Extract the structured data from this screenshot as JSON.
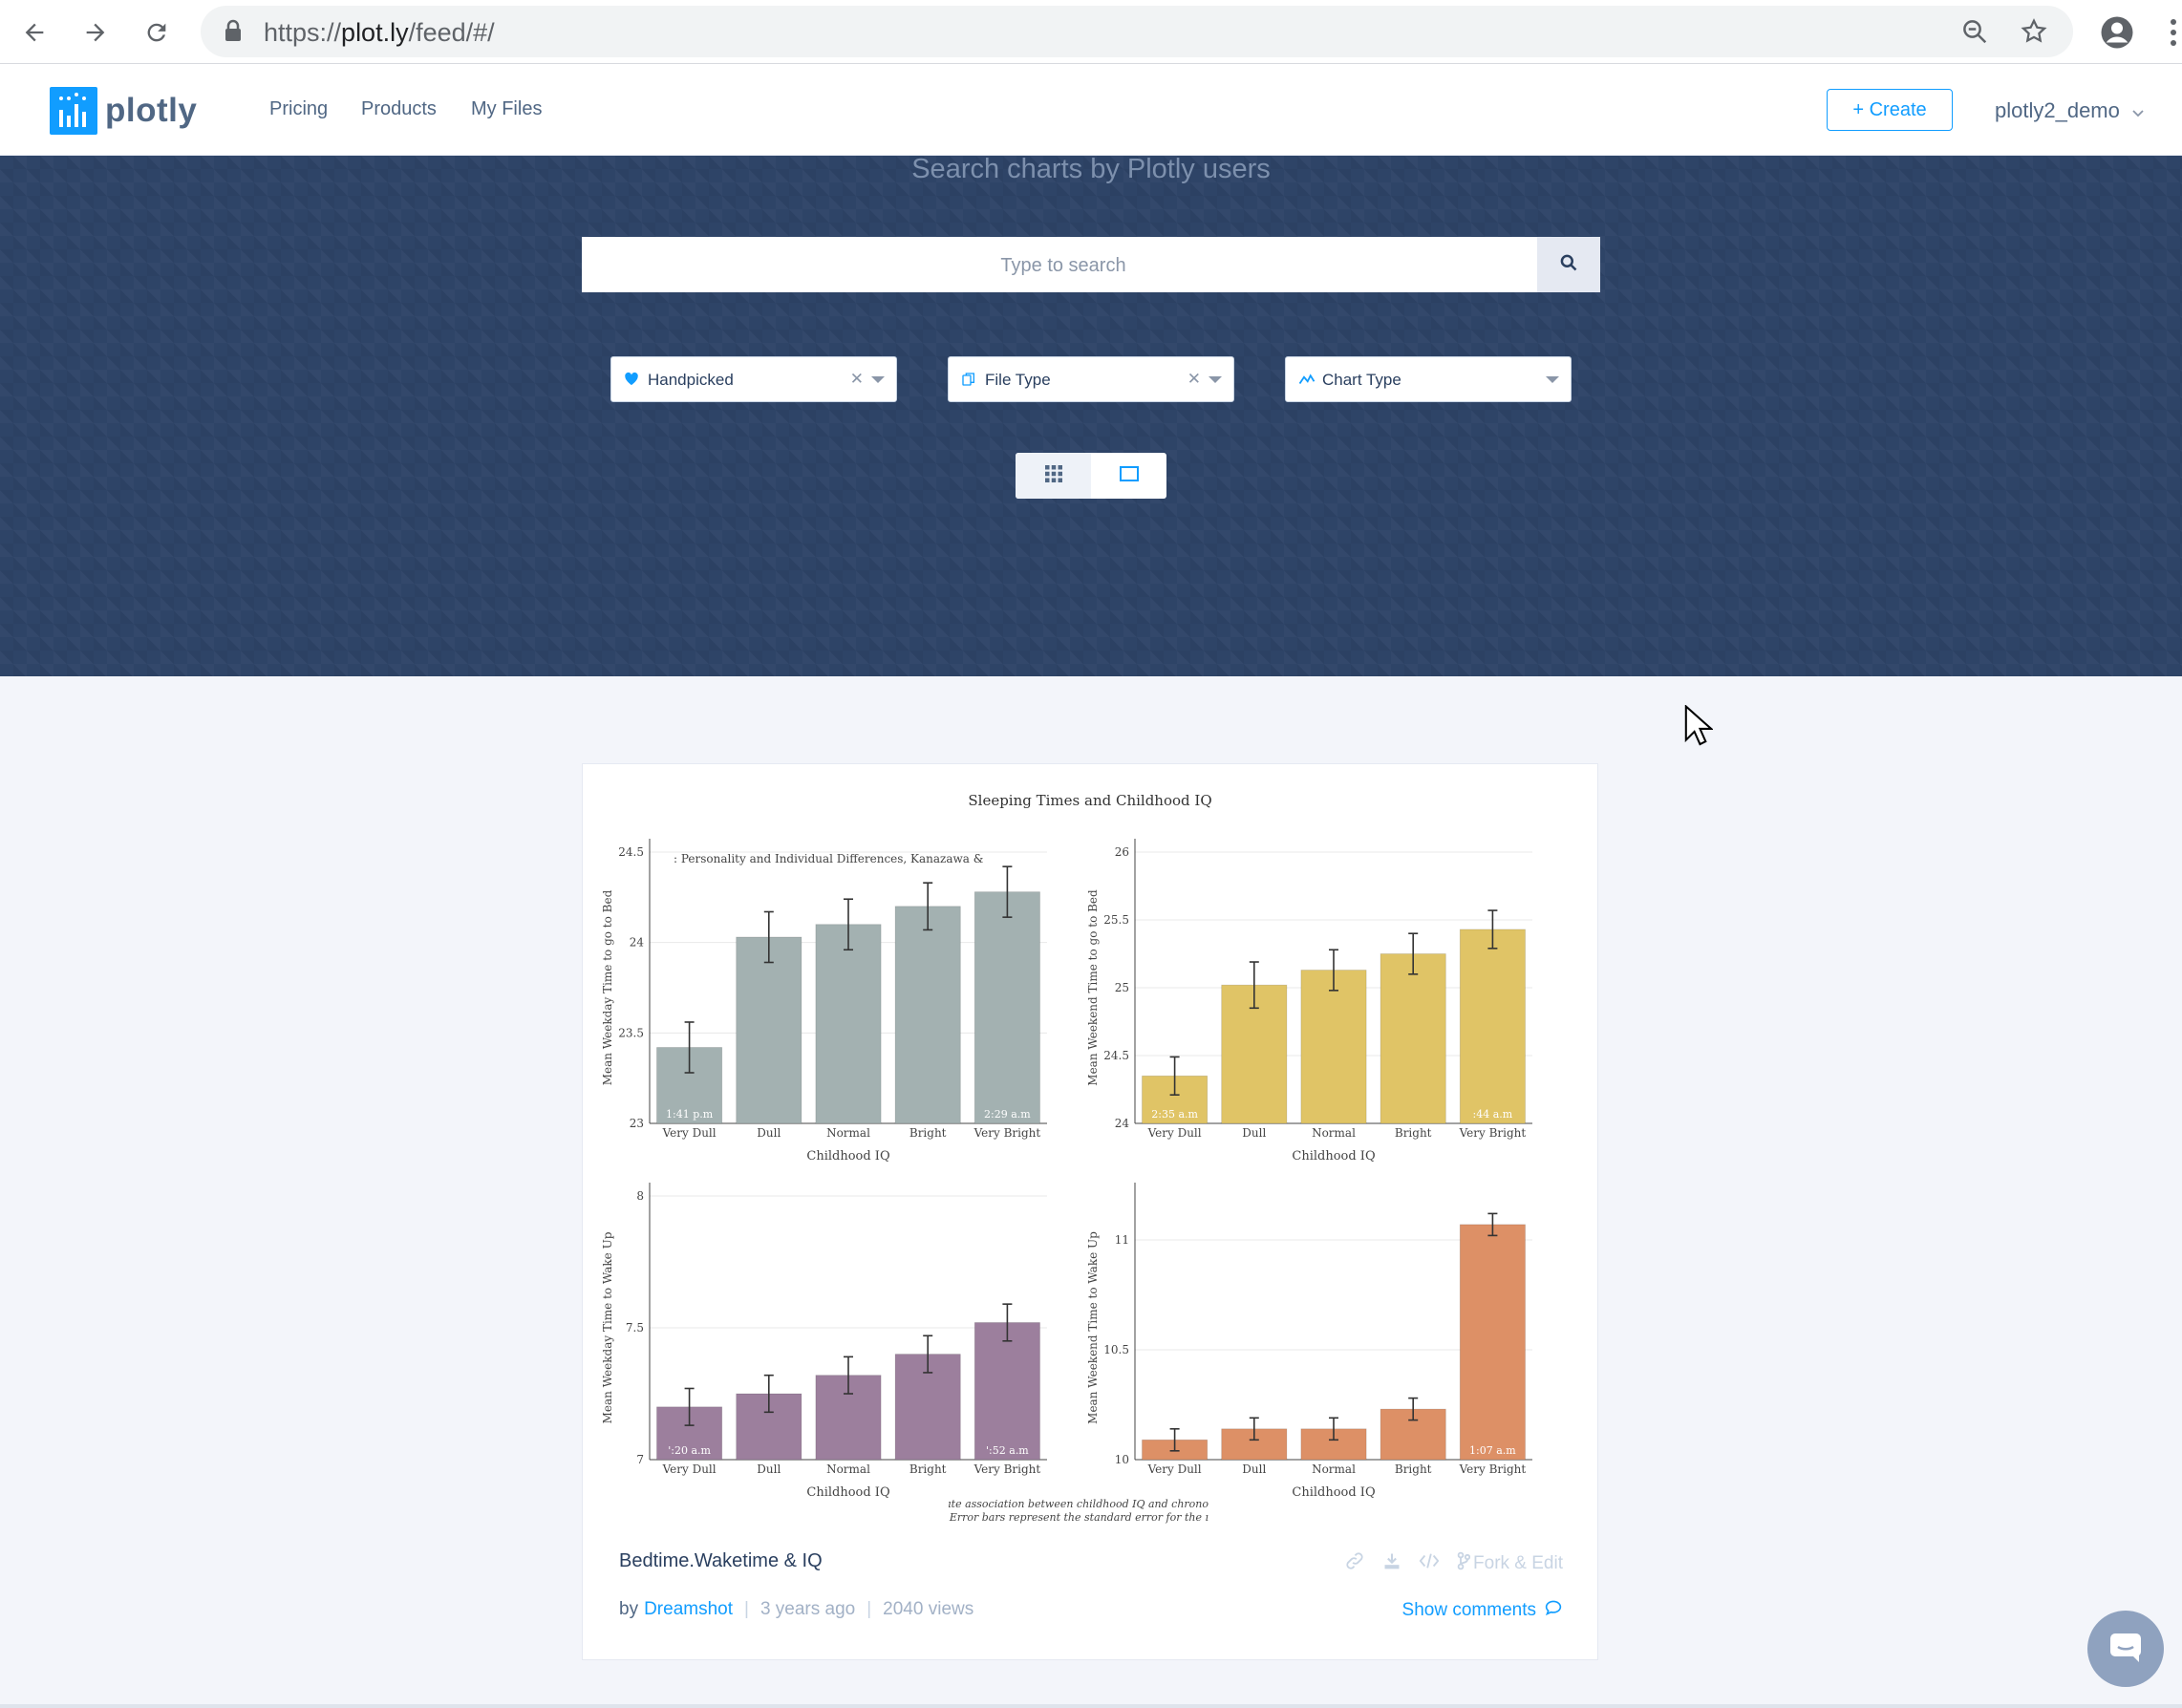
{
  "browser": {
    "url_prefix": "https://",
    "url_host": "plot.ly",
    "url_path": "/feed/#/"
  },
  "site": {
    "logo_text": "plotly",
    "nav": [
      "Pricing",
      "Products",
      "My Files"
    ],
    "create_label": "+ Create",
    "username": "plotly2_demo"
  },
  "hero": {
    "title": "Search charts by Plotly users",
    "search_placeholder": "Type to search",
    "filters": [
      {
        "label": "Handpicked",
        "icon": "heart-icon",
        "clearable": true
      },
      {
        "label": "File Type",
        "icon": "file-copy-icon",
        "clearable": true
      },
      {
        "label": "Chart Type",
        "icon": "line-chart-icon",
        "clearable": false
      }
    ]
  },
  "card": {
    "title": "Bedtime.Waketime & IQ",
    "fork_label": "Fork & Edit",
    "author_prefix": "by",
    "author": "Dreamshot",
    "age": "3 years ago",
    "views": "2040 views",
    "comments_label": "Show comments"
  },
  "chart_data": {
    "type": "bar",
    "title": "Sleeping Times and Childhood IQ",
    "source_note": ": Personality and Individual Differences, Kanazawa &",
    "caption_lines": [
      "ıte association between childhood IQ and chrono",
      "Error bars represent the standard error for the ı"
    ],
    "subplots": [
      {
        "ylabel": "Mean Weekday Time to go to Bed",
        "xlabel": "Childhood IQ",
        "categories": [
          "Very Dull",
          "Dull",
          "Normal",
          "Bright",
          "Very Bright"
        ],
        "values": [
          23.42,
          24.03,
          24.1,
          24.2,
          24.28
        ],
        "errors": [
          0.14,
          0.14,
          0.14,
          0.13,
          0.14
        ],
        "ylim": [
          23,
          24.5
        ],
        "yticks": [
          "23",
          "23.5",
          "24",
          "24.5"
        ],
        "color": "#a3b1b1",
        "bar_labels": [
          "1:41 p.m",
          "",
          "",
          "",
          "2:29 a.m"
        ]
      },
      {
        "ylabel": "Mean Weekend Time to go to Bed",
        "xlabel": "Childhood IQ",
        "categories": [
          "Very Dull",
          "Dull",
          "Normal",
          "Bright",
          "Very Bright"
        ],
        "values": [
          24.35,
          25.02,
          25.13,
          25.25,
          25.43
        ],
        "errors": [
          0.14,
          0.17,
          0.15,
          0.15,
          0.14
        ],
        "ylim": [
          24,
          26
        ],
        "yticks": [
          "24",
          "24.5",
          "25",
          "25.5",
          "26"
        ],
        "color": "#e0c466",
        "bar_labels": [
          "2:35 a.m",
          "",
          "",
          "",
          ":44 a.m"
        ]
      },
      {
        "ylabel": "Mean Weekday Time to Wake Up",
        "xlabel": "Childhood IQ",
        "categories": [
          "Very Dull",
          "Dull",
          "Normal",
          "Bright",
          "Very Bright"
        ],
        "values": [
          7.2,
          7.25,
          7.32,
          7.4,
          7.52
        ],
        "errors": [
          0.07,
          0.07,
          0.07,
          0.07,
          0.07
        ],
        "ylim": [
          7,
          8
        ],
        "yticks": [
          "7",
          "7.5",
          "8"
        ],
        "color": "#9c7f9d",
        "bar_labels": [
          "':20 a.m",
          "",
          "",
          "",
          "':52 a.m"
        ]
      },
      {
        "ylabel": "Mean Weekend Time to Wake Up",
        "xlabel": "Childhood IQ",
        "categories": [
          "Very Dull",
          "Dull",
          "Normal",
          "Bright",
          "Very Bright"
        ],
        "values": [
          10.09,
          10.14,
          10.14,
          10.23,
          11.07
        ],
        "errors": [
          0.05,
          0.05,
          0.05,
          0.05,
          0.05
        ],
        "ylim": [
          10,
          11.2
        ],
        "yticks": [
          "10",
          "10.5",
          "11"
        ],
        "color": "#dd9066",
        "bar_labels": [
          "",
          "",
          "",
          "",
          "1:07 a.m"
        ]
      }
    ]
  }
}
